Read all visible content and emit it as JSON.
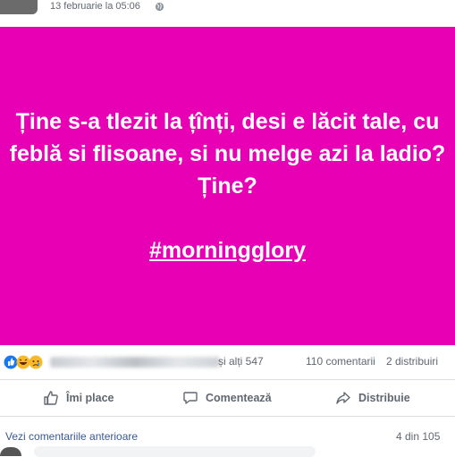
{
  "post": {
    "timestamp": "13 februarie la 05:06",
    "text": "Ține s-a tlezit la țînți, desi e lăcit tale, cu feblă si flisoane, si nu melge azi la ladio? Ține?",
    "hashtag": "#morningglory",
    "background_color": "#e800b5"
  },
  "reactions": {
    "icons": [
      "like-icon",
      "haha-icon",
      "sad-icon"
    ],
    "others": "și alți 547",
    "comments": "110 comentarii",
    "shares": "2 distribuiri"
  },
  "actions": {
    "like": "Îmi place",
    "comment": "Comentează",
    "share": "Distribuie"
  },
  "comments": {
    "more_label": "Vezi comentariile anterioare",
    "counter": "4 din 105"
  }
}
